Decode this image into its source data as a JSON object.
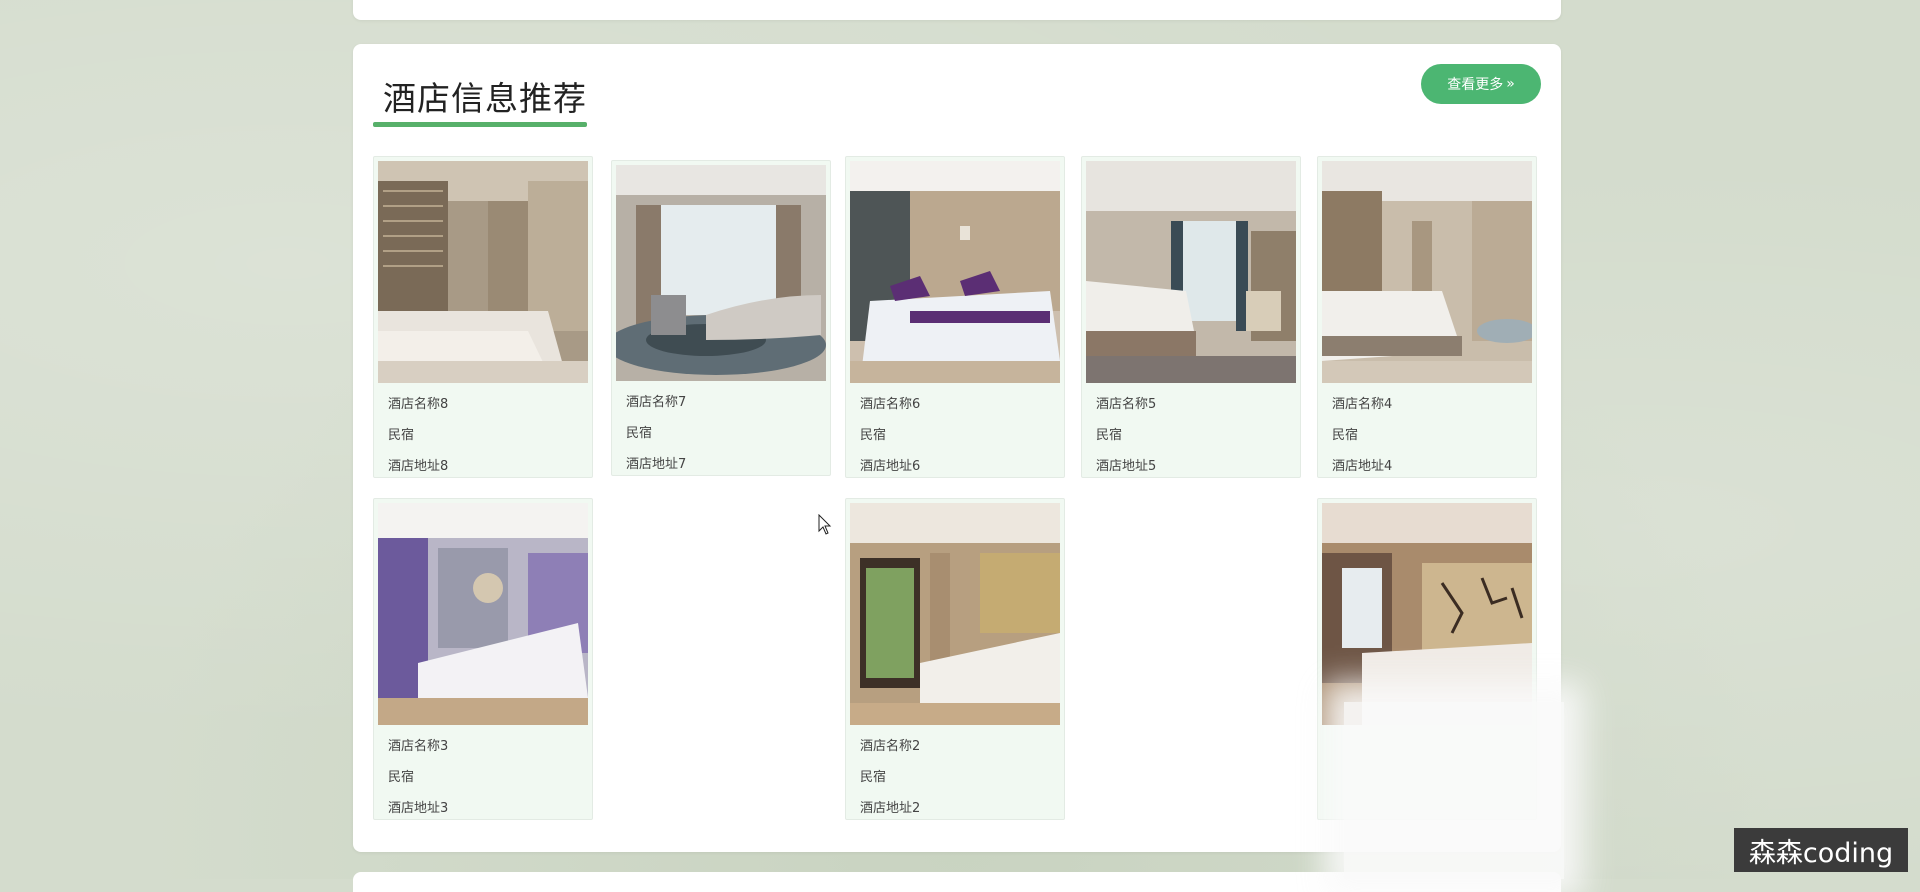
{
  "section": {
    "title": "酒店信息推荐",
    "more_label": "查看更多",
    "more_icon": "double-chevron-right-icon",
    "accent_color": "#4cb672"
  },
  "hotels": [
    {
      "name": "酒店名称8",
      "type": "民宿",
      "address": "酒店地址8"
    },
    {
      "name": "酒店名称7",
      "type": "民宿",
      "address": "酒店地址7"
    },
    {
      "name": "酒店名称6",
      "type": "民宿",
      "address": "酒店地址6"
    },
    {
      "name": "酒店名称5",
      "type": "民宿",
      "address": "酒店地址5"
    },
    {
      "name": "酒店名称4",
      "type": "民宿",
      "address": "酒店地址4"
    },
    {
      "name": "酒店名称3",
      "type": "民宿",
      "address": "酒店地址3"
    },
    {
      "name": "酒店名称2",
      "type": "民宿",
      "address": "酒店地址2"
    },
    {
      "name": "",
      "type": "",
      "address": ""
    }
  ],
  "watermark": "森森coding"
}
